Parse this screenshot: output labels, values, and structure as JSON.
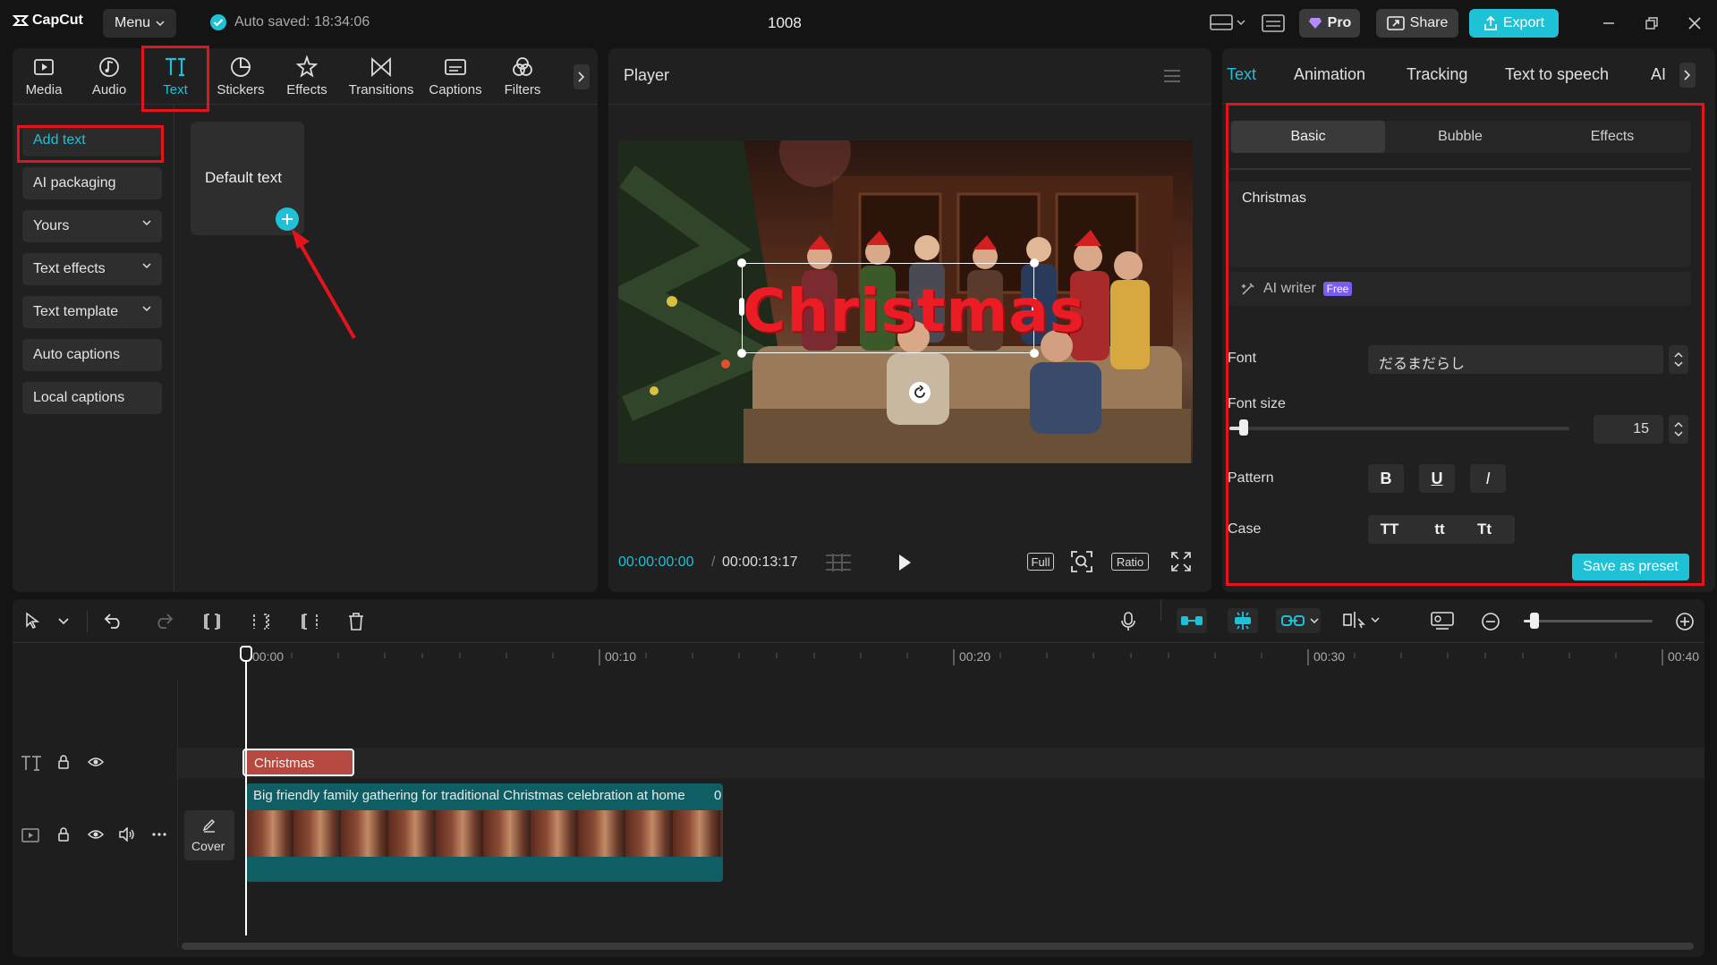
{
  "app": {
    "logo_text": "CapCut",
    "menu_label": "Menu",
    "autosave_text": "Auto saved: 18:34:06",
    "project_title": "1008",
    "pro_label": "Pro",
    "share_label": "Share",
    "export_label": "Export"
  },
  "toolbar": {
    "tabs": [
      {
        "label": "Media",
        "icon": "media-icon"
      },
      {
        "label": "Audio",
        "icon": "audio-icon"
      },
      {
        "label": "Text",
        "icon": "text-icon"
      },
      {
        "label": "Stickers",
        "icon": "stickers-icon"
      },
      {
        "label": "Effects",
        "icon": "effects-icon"
      },
      {
        "label": "Transitions",
        "icon": "transitions-icon"
      },
      {
        "label": "Captions",
        "icon": "captions-icon"
      },
      {
        "label": "Filters",
        "icon": "filters-icon"
      }
    ]
  },
  "sidebar": {
    "items": [
      {
        "label": "Add text"
      },
      {
        "label": "AI packaging"
      },
      {
        "label": "Yours"
      },
      {
        "label": "Text effects"
      },
      {
        "label": "Text template"
      },
      {
        "label": "Auto captions"
      },
      {
        "label": "Local captions"
      }
    ]
  },
  "library": {
    "default_text_label": "Default text"
  },
  "player": {
    "title": "Player",
    "overlay_text": "Christmas",
    "current_time": "00:00:00:00",
    "total_time": "00:00:13:17",
    "full_label": "Full",
    "ratio_label": "Ratio"
  },
  "properties": {
    "tabs": [
      "Text",
      "Animation",
      "Tracking",
      "Text to speech",
      "AI"
    ],
    "segments": [
      "Basic",
      "Bubble",
      "Effects"
    ],
    "text_value": "Christmas",
    "ai_writer_label": "AI writer",
    "free_badge": "Free",
    "font_label": "Font",
    "font_value": "だるまだらし",
    "font_size_label": "Font size",
    "font_size_value": "15",
    "pattern_label": "Pattern",
    "pattern_buttons": [
      "B",
      "U",
      "I"
    ],
    "case_label": "Case",
    "case_buttons": [
      "TT",
      "tt",
      "Tt"
    ],
    "save_preset_label": "Save as preset"
  },
  "timeline": {
    "ruler": [
      "00:00",
      "00:10",
      "00:20",
      "00:30",
      "00:40"
    ],
    "text_clip_label": "Christmas",
    "video_clip_label": "Big friendly family gathering for traditional Christmas celebration at home",
    "video_clip_suffix": "0",
    "cover_label": "Cover"
  },
  "colors": {
    "accent": "#1fc1d7",
    "highlight_red": "#e3141c",
    "text_clip": "#b5483f",
    "video_clip": "#0f5e63"
  }
}
